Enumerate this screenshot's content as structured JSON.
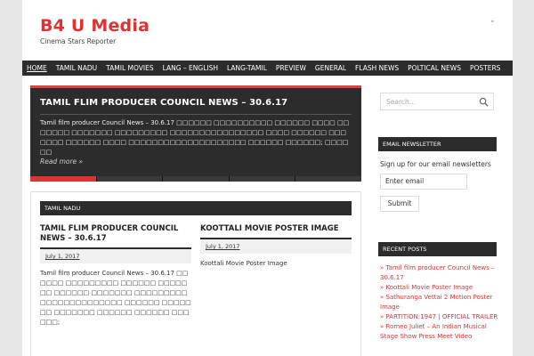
{
  "header": {
    "site_title": "B4 U Media",
    "tagline": "Cinema Stars Reporter",
    "dot": "•"
  },
  "nav": {
    "items": [
      {
        "label": "HOME"
      },
      {
        "label": "TAMIL NADU"
      },
      {
        "label": "TAMIL MOVIES"
      },
      {
        "label": "LANG – ENGLISH"
      },
      {
        "label": "LANG-TAMIL"
      },
      {
        "label": "PREVIEW"
      },
      {
        "label": "GENERAL"
      },
      {
        "label": "FLASH NEWS"
      },
      {
        "label": "POLTICAL NEWS"
      },
      {
        "label": "POSTERS"
      }
    ]
  },
  "slider": {
    "title": "TAMIL FLIM PRODUCER COUNCIL NEWS – 30.6.17",
    "excerpt": "Tamil film producer Council News – 30.6.17 □□□□□□ □□□□□□□□□□ □□□□□□ □□□□ □□□□□□□ □□□□□□□ □□□□□□□□□ □□□□□□□□□□□□□□□□ □□□□ □□□□□□ □□□□□□□ □□□□□□ □□□□ □□□□□□□□□□□□□□□□□□□□ □□□□□□ □□□□□□; □□□□□□",
    "read_more": "Read more »",
    "accent": "#dd3333"
  },
  "category": {
    "label": "TAMIL NADU",
    "posts": [
      {
        "title": "TAMIL FLIM PRODUCER COUNCIL NEWS – 30.6.17",
        "date": "July 1, 2017",
        "excerpt": "Tamil film producer Council News – 30.6.17 □□□□□□ □□□□□□□□□ □□□□□□ □□□□□□□ □□□□□□ □□□□□□□ □□□□□□□□□ □□□□□□□□□□□□□□ □□□□□□ □□□□□□□ □□□□□□□ □□□□□□ □□□□□□ □□□□□□;"
      },
      {
        "title": "KOOTTALI MOVIE POSTER IMAGE",
        "date": "July 1, 2017",
        "excerpt": "Koottali Movie Poster Image"
      }
    ]
  },
  "sidebar": {
    "search_placeholder": "Search...",
    "newsletter_title": "EMAIL NEWSLETTER",
    "newsletter_text": "Sign up for our email newsletters",
    "email_placeholder": "Enter email",
    "submit_label": "Submit",
    "recent_title": "RECENT POSTS",
    "recent_posts": [
      "Tamil film producer Council News – 30.6.17",
      "Koottali Movie Poster Image",
      "Sathuranga Vettai 2 Motion Poster Image",
      "PARTITION:1947 | OFFICIAL TRAILER",
      "Romeo Juliet – An Indian Musical Stage Show Press Meet Video"
    ]
  }
}
